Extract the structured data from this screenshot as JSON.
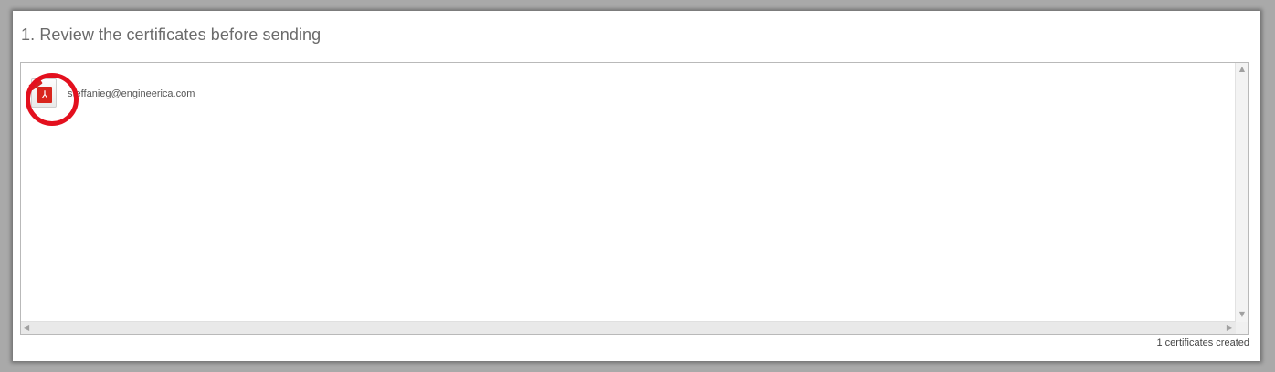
{
  "section": {
    "title": "1. Review the certificates before sending"
  },
  "certificates": {
    "items": [
      {
        "icon": "pdf-file-icon",
        "label": "steffanieg@engineerica.com"
      }
    ]
  },
  "footer": {
    "status": "1 certificates created"
  },
  "colors": {
    "highlight_ring": "#e3101e",
    "pdf_red": "#d9251d"
  }
}
